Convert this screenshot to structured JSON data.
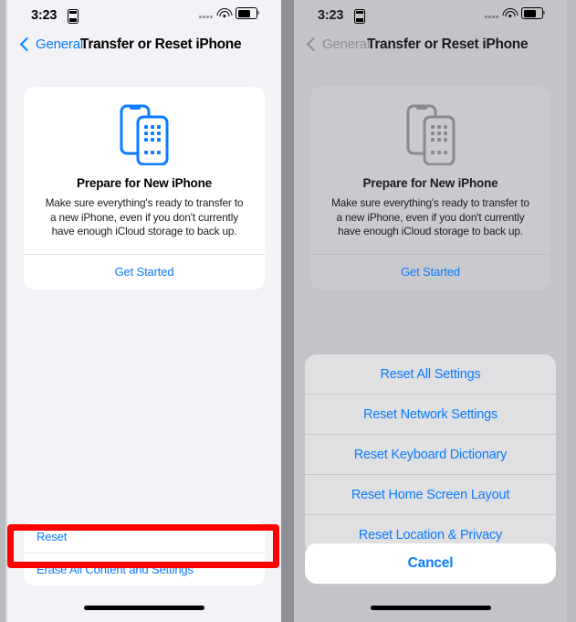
{
  "theme": {
    "accent": "#0a7cff",
    "highlight": "#fe0000",
    "screen_bg": "#f2f2f7",
    "screen_bg_dimmed": "#c3c4c8",
    "card_bg": "#ffffff",
    "sheet_bg": "#e0e0e2"
  },
  "status_bar": {
    "time": "3:23",
    "battery_icon": "battery-icon",
    "wifi_icon": "wifi-icon",
    "signal_icon": "cellular-signal-icon",
    "lock_icon": "battery-charging-icon"
  },
  "nav": {
    "back_label": "General",
    "title": "Transfer or Reset iPhone",
    "back_icon": "chevron-left-icon"
  },
  "prepare_card": {
    "icon": "two-iphones-icon",
    "title": "Prepare for New iPhone",
    "body": "Make sure everything's ready to transfer to a new iPhone, even if you don't currently have enough iCloud storage to back up.",
    "action_label": "Get Started"
  },
  "bottom_list": {
    "rows": [
      {
        "label": "Reset"
      },
      {
        "label": "Erase All Content and Settings"
      }
    ]
  },
  "action_sheet": {
    "options": [
      {
        "label": "Reset All Settings"
      },
      {
        "label": "Reset Network Settings"
      },
      {
        "label": "Reset Keyboard Dictionary"
      },
      {
        "label": "Reset Home Screen Layout"
      },
      {
        "label": "Reset Location & Privacy"
      }
    ],
    "cancel_label": "Cancel"
  },
  "annotations": [
    {
      "name": "reset-row-highlight",
      "target": "Reset"
    },
    {
      "name": "reset-network-settings-highlight",
      "target": "Reset Network Settings"
    }
  ]
}
